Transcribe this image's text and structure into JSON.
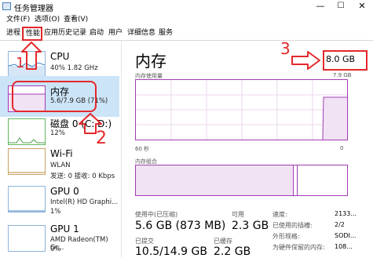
{
  "window": {
    "title": "任务管理器",
    "min": "—",
    "max": "☐",
    "close": "✕"
  },
  "menu": [
    "文件(F)",
    "选项(O)",
    "查看(V)"
  ],
  "tabs": [
    "进程",
    "性能",
    "应用历史记录",
    "启动",
    "用户",
    "详细信息",
    "服务"
  ],
  "sidebar": {
    "items": [
      {
        "name": "CPU",
        "sub": "40%  1.82 GHz",
        "sub2": ""
      },
      {
        "name": "内存",
        "sub": "5.6/7.9 GB (71%)",
        "sub2": ""
      },
      {
        "name": "磁盘 0 (C: D:)",
        "sub": "12%",
        "sub2": ""
      },
      {
        "name": "Wi-Fi",
        "sub": "WLAN",
        "sub2": "发送: 0 接收: 0 Kbps"
      },
      {
        "name": "GPU 0",
        "sub": "Intel(R) HD Graphi...",
        "sub2": "1%"
      },
      {
        "name": "GPU 1",
        "sub": "AMD Radeon(TM) Gr...",
        "sub2": "0%"
      }
    ]
  },
  "main": {
    "title": "内存",
    "total": "8.0 GB",
    "usage_label": "内存使用量",
    "usage_max": "7.9 GB",
    "axis_left": "60 秒",
    "axis_right": "0",
    "composition_label": "内存组合",
    "stats": {
      "in_use_label": "使用中(已压缩)",
      "in_use_value": "5.6 GB (873 MB)",
      "available_label": "可用",
      "available_value": "2.3 GB",
      "committed_label": "已提交",
      "committed_value": "10.5/14.9 GB",
      "cached_label": "已缓存",
      "cached_value": "2.2 GB"
    },
    "details": [
      {
        "label": "速度:",
        "value": "2133..."
      },
      {
        "label": "已使用的插槽:",
        "value": "2/2"
      },
      {
        "label": "外形规格:",
        "value": "SODI..."
      },
      {
        "label": "为硬件保留的内存:",
        "value": "108..."
      }
    ]
  },
  "annotations": {
    "n1": "1",
    "n2": "2",
    "n3": "3"
  },
  "colors": {
    "memory_accent": "#a23cb4",
    "annotation_red": "#e3282b",
    "selected_bg": "#cce4f7"
  }
}
